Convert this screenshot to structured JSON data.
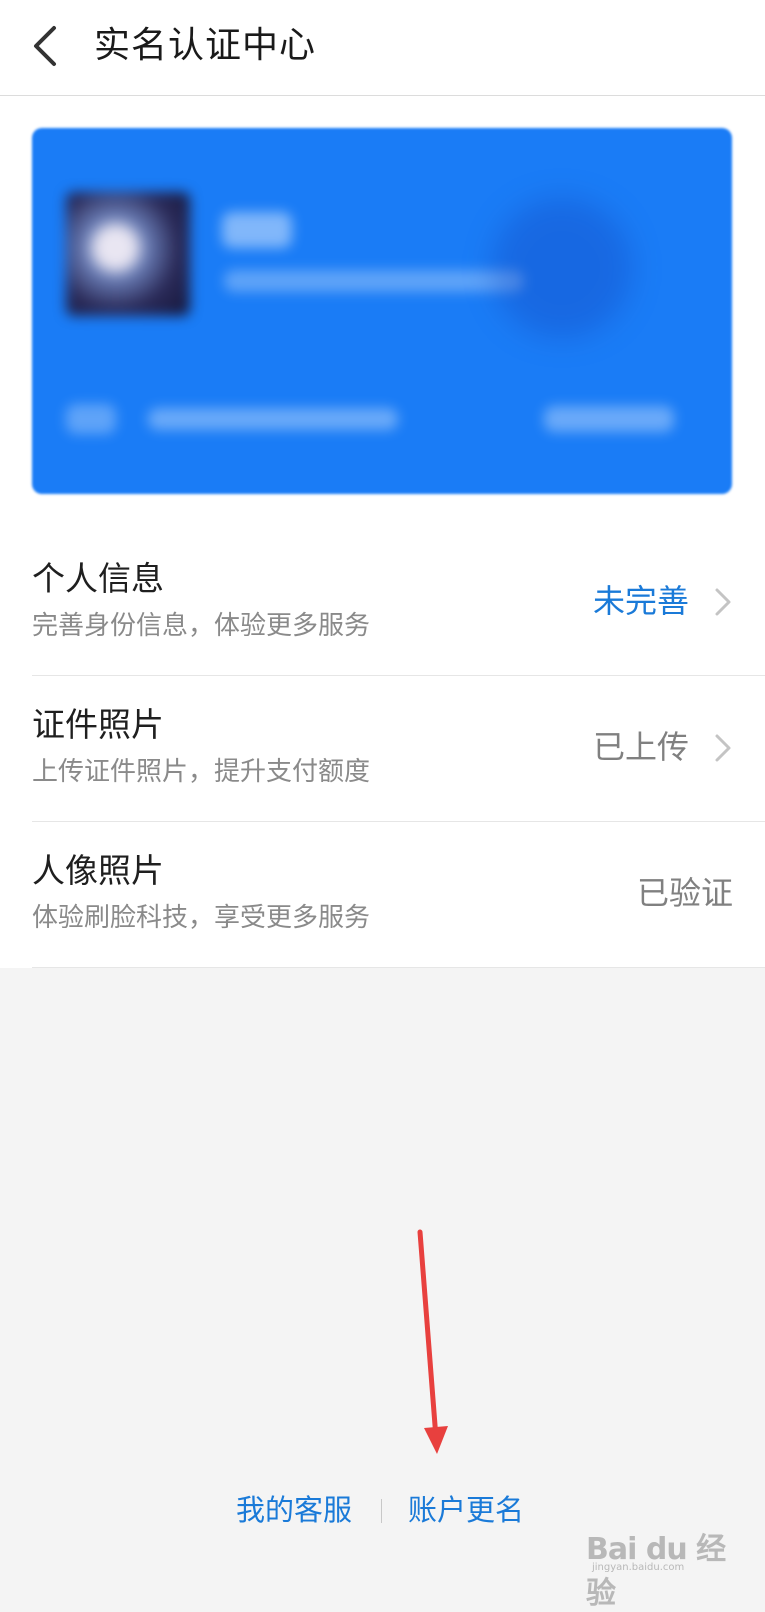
{
  "header": {
    "title": "实名认证中心",
    "back_icon": "chevron-left-icon"
  },
  "card": {
    "color": "#1a7cf6",
    "content_blurred": true
  },
  "rows": [
    {
      "title": "个人信息",
      "subtitle": "完善身份信息，体验更多服务",
      "status": "未完善",
      "status_color": "#1a7ad8",
      "has_arrow": true
    },
    {
      "title": "证件照片",
      "subtitle": "上传证件照片，提升支付额度",
      "status": "已上传",
      "status_color": "#808080",
      "has_arrow": true
    },
    {
      "title": "人像照片",
      "subtitle": "体验刷脸科技，享受更多服务",
      "status": "已验证",
      "status_color": "#808080",
      "has_arrow": false
    }
  ],
  "footer": {
    "customer_service": "我的客服",
    "rename_account": "账户更名"
  },
  "annotation": {
    "arrow_color": "#e8403e"
  },
  "watermark": {
    "brand": "Bai du 经验",
    "url": "jingyan.baidu.com"
  }
}
